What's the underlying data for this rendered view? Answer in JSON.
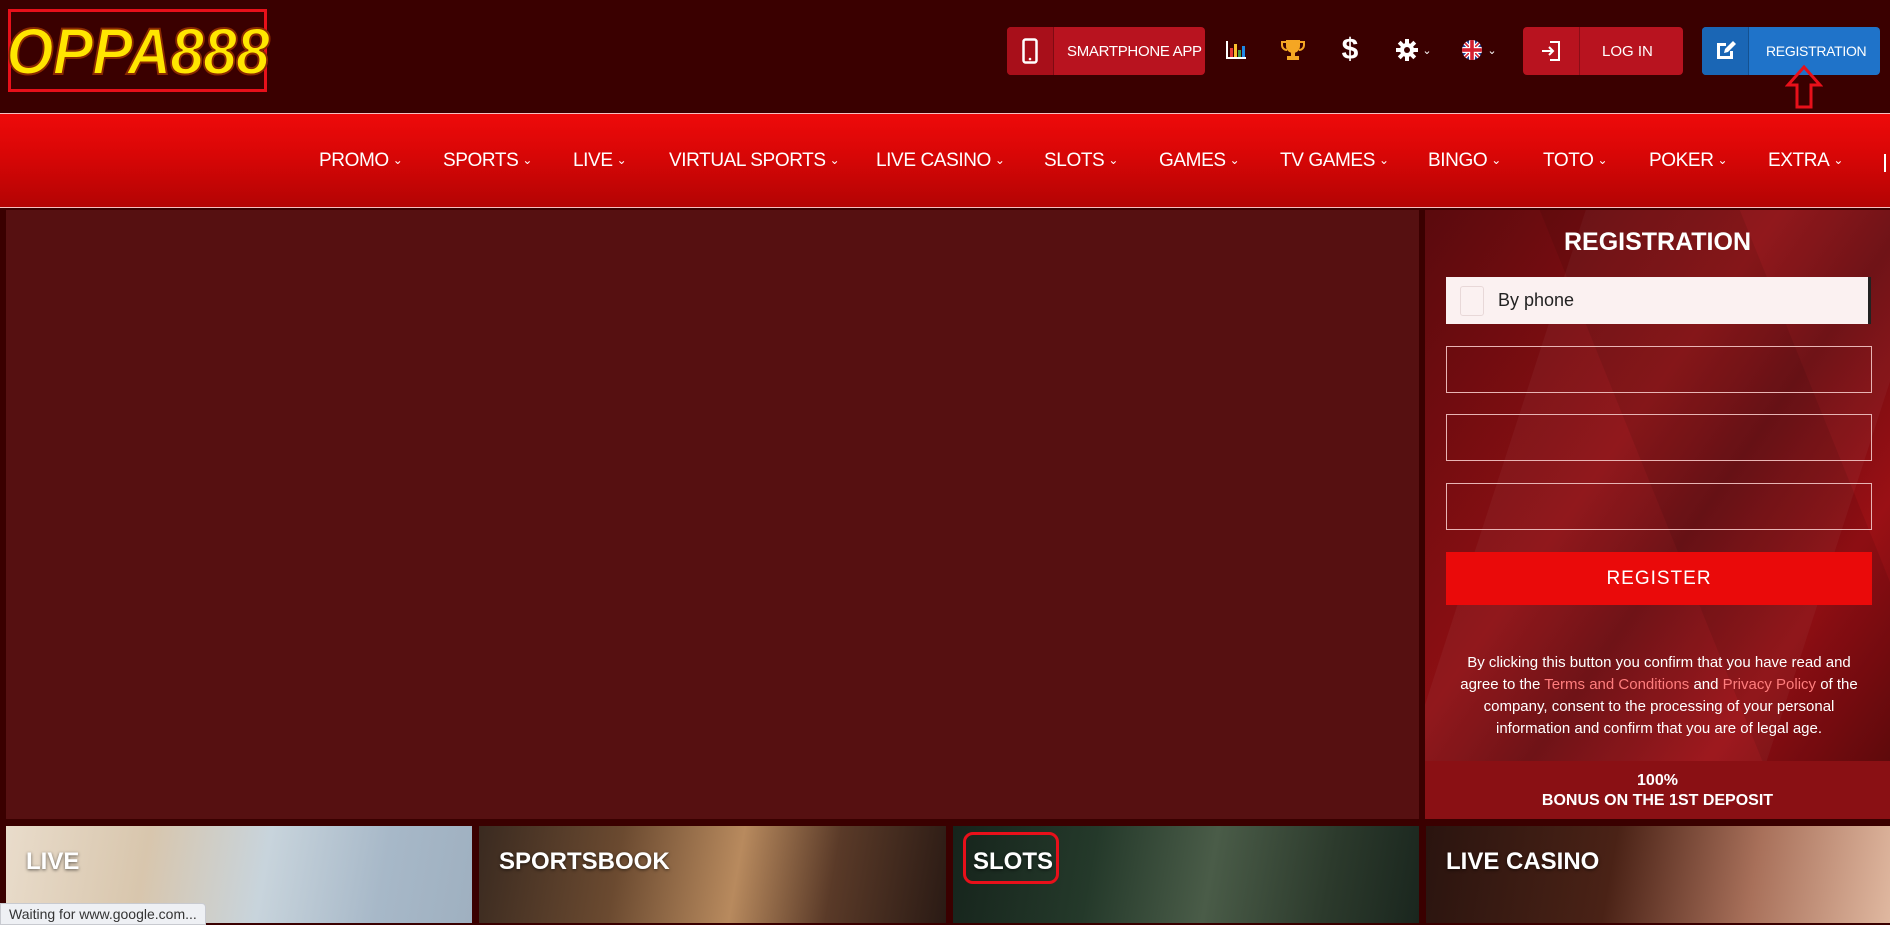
{
  "header": {
    "logo_text": "OPPA888",
    "app_button_label": "SMARTPHONE APP",
    "login_label": "LOG IN",
    "registration_label": "REGISTRATION",
    "icons": [
      "statistics-icon",
      "trophy-icon",
      "dollar-icon",
      "settings-icon",
      "language-flag-icon"
    ]
  },
  "nav": {
    "items": [
      {
        "label": "PROMO"
      },
      {
        "label": "SPORTS"
      },
      {
        "label": "LIVE"
      },
      {
        "label": "VIRTUAL SPORTS"
      },
      {
        "label": "LIVE CASINO"
      },
      {
        "label": "SLOTS"
      },
      {
        "label": "GAMES"
      },
      {
        "label": "TV GAMES"
      },
      {
        "label": "BINGO"
      },
      {
        "label": "TOTO"
      },
      {
        "label": "POKER"
      },
      {
        "label": "EXTRA"
      }
    ]
  },
  "registration": {
    "title": "REGISTRATION",
    "method_selected": "By phone",
    "field_1": "",
    "field_2": "",
    "field_3": "",
    "submit_label": "REGISTER",
    "terms_before": "By clicking this button you confirm that you have read and agree to the ",
    "terms_link": "Terms and Conditions",
    "terms_and": " and ",
    "privacy_link": "Privacy Policy",
    "terms_after": " of the company, consent to the processing of your personal information and confirm that you are of legal age.",
    "bonus_line1": "100%",
    "bonus_line2": "BONUS ON THE 1ST DEPOSIT"
  },
  "tiles": [
    {
      "label": "LIVE"
    },
    {
      "label": "SPORTSBOOK"
    },
    {
      "label": "SLOTS"
    },
    {
      "label": "LIVE CASINO"
    }
  ],
  "status_text": "Waiting for www.google.com...",
  "colors": {
    "background": "#3a0000",
    "nav_red": "#e00808",
    "accent_red": "#ea0a0a",
    "registration_blue": "#1f73c9",
    "logo_yellow": "#ffe600"
  }
}
